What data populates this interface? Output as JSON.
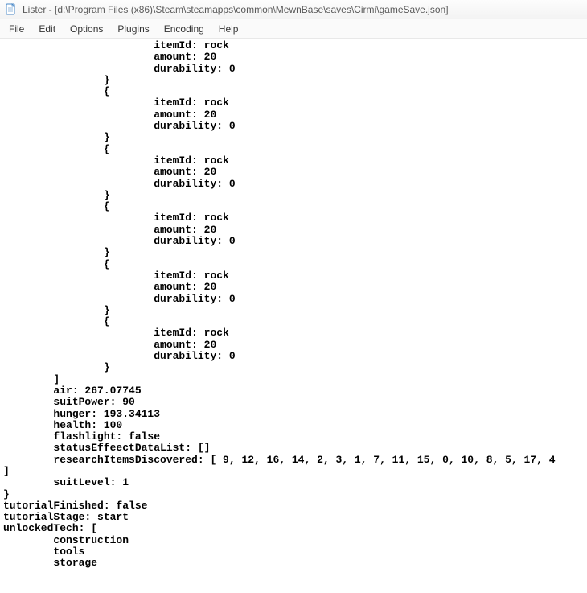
{
  "window": {
    "title": "Lister - [d:\\Program Files (x86)\\Steam\\steamapps\\common\\MewnBase\\saves\\Cirmi\\gameSave.json]"
  },
  "menu": {
    "items": [
      "File",
      "Edit",
      "Options",
      "Plugins",
      "Encoding",
      "Help"
    ]
  },
  "content": {
    "text": "                        itemId: rock\n                        amount: 20\n                        durability: 0\n                }\n                {\n                        itemId: rock\n                        amount: 20\n                        durability: 0\n                }\n                {\n                        itemId: rock\n                        amount: 20\n                        durability: 0\n                }\n                {\n                        itemId: rock\n                        amount: 20\n                        durability: 0\n                }\n                {\n                        itemId: rock\n                        amount: 20\n                        durability: 0\n                }\n                {\n                        itemId: rock\n                        amount: 20\n                        durability: 0\n                }\n        ]\n        air: 267.07745\n        suitPower: 90\n        hunger: 193.34113\n        health: 100\n        flashlight: false\n        statusEffeectDataList: []\n        researchItemsDiscovered: [ 9, 12, 16, 14, 2, 3, 1, 7, 11, 15, 0, 10, 8, 5, 17, 4\n]\n        suitLevel: 1\n}\ntutorialFinished: false\ntutorialStage: start\nunlockedTech: [\n        construction\n        tools\n        storage"
  }
}
